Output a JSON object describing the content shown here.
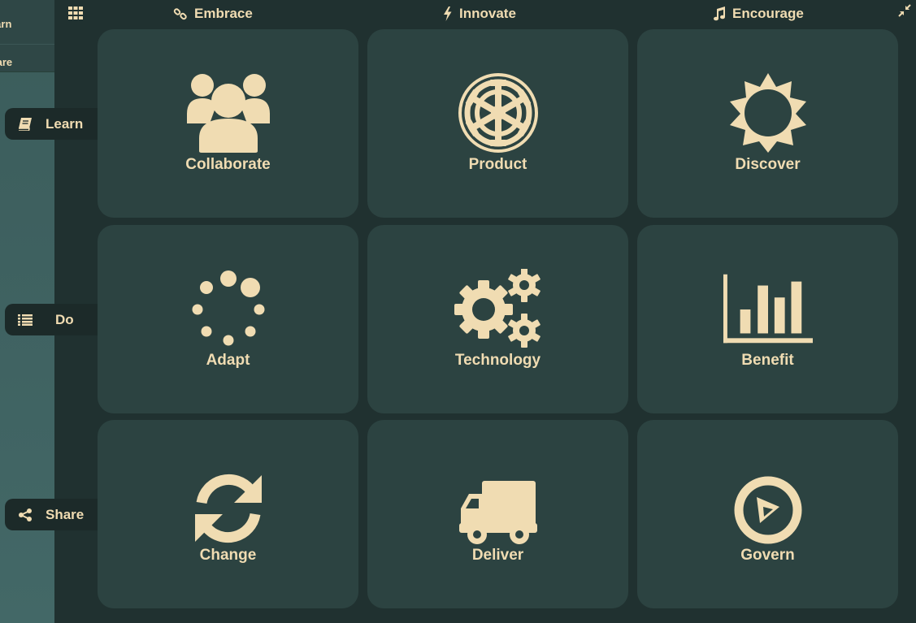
{
  "left_panel": {
    "items": [
      {
        "label": "Learn"
      },
      {
        "label": "Share"
      }
    ]
  },
  "top_nav": {
    "items": [
      {
        "label": "Embrace",
        "icon": "link-icon"
      },
      {
        "label": "Innovate",
        "icon": "bolt-icon"
      },
      {
        "label": "Encourage",
        "icon": "music-icon"
      }
    ]
  },
  "side_tabs": [
    {
      "label": "Learn",
      "icon": "book-icon"
    },
    {
      "label": "Do",
      "icon": "list-icon"
    },
    {
      "label": "Share",
      "icon": "share-icon"
    }
  ],
  "tiles": [
    {
      "label": "Collaborate",
      "icon": "users-icon"
    },
    {
      "label": "Product",
      "icon": "empire-icon"
    },
    {
      "label": "Discover",
      "icon": "sun-icon"
    },
    {
      "label": "Adapt",
      "icon": "spinner-icon"
    },
    {
      "label": "Technology",
      "icon": "gears-icon"
    },
    {
      "label": "Benefit",
      "icon": "bar-chart-icon"
    },
    {
      "label": "Change",
      "icon": "refresh-icon"
    },
    {
      "label": "Deliver",
      "icon": "truck-icon"
    },
    {
      "label": "Govern",
      "icon": "compass-icon"
    }
  ],
  "colors": {
    "accent": "#f0dcb2",
    "tile_bg": "#2c4341",
    "panel_bg": "#203130",
    "tab_bg": "#1c2a29",
    "left_strip": "#3f6261"
  }
}
